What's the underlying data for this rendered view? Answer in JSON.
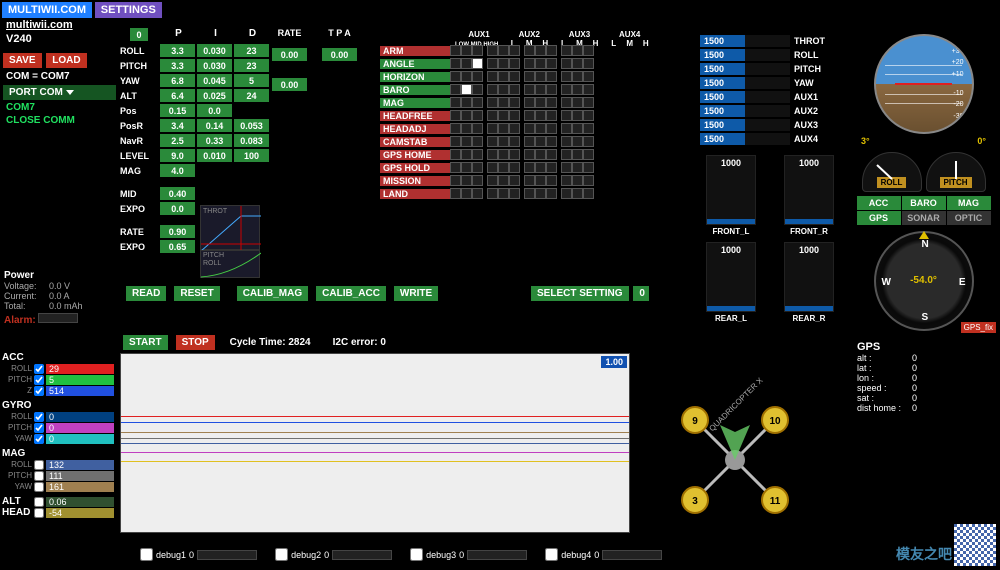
{
  "tabs": {
    "multiwii": "MULTIWII.COM",
    "settings": "SETTINGS"
  },
  "header": {
    "site": "multiwii.com",
    "version": "V240"
  },
  "file": {
    "save": "SAVE",
    "load": "LOAD"
  },
  "com_status": "COM = COM7",
  "port": {
    "port_com": "PORT COM",
    "com7": "COM7",
    "close": "CLOSE COMM"
  },
  "power": {
    "title": "Power",
    "voltage_lbl": "Voltage:",
    "voltage": "0.0 V",
    "current_lbl": "Current:",
    "current": "0.0 A",
    "total_lbl": "Total:",
    "total": "0.0 mAh",
    "alarm": "Alarm:"
  },
  "sensors": {
    "acc": {
      "hdr": "ACC",
      "roll": "29",
      "pitch": "5",
      "z": "514"
    },
    "gyro": {
      "hdr": "GYRO",
      "roll": "0",
      "pitch": "0",
      "yaw": "0"
    },
    "mag": {
      "hdr": "MAG",
      "roll": "132",
      "pitch": "111",
      "yaw": "161"
    },
    "alt": {
      "hdr": "ALT",
      "val": "0.06"
    },
    "head": {
      "hdr": "HEAD",
      "val": "-54"
    }
  },
  "axes": {
    "roll": "ROLL",
    "pitch": "PITCH",
    "yaw": "YAW",
    "z": "Z"
  },
  "pid": {
    "hdr": {
      "zero": "0",
      "p": "P",
      "i": "I",
      "d": "D",
      "rate": "RATE",
      "tpa": "T P A"
    },
    "rows": [
      {
        "name": "ROLL",
        "p": "3.3",
        "i": "0.030",
        "d": "23"
      },
      {
        "name": "PITCH",
        "p": "3.3",
        "i": "0.030",
        "d": "23"
      },
      {
        "name": "YAW",
        "p": "6.8",
        "i": "0.045",
        "d": "5"
      },
      {
        "name": "ALT",
        "p": "6.4",
        "i": "0.025",
        "d": "24"
      },
      {
        "name": "Pos",
        "p": "0.15",
        "i": "0.0"
      },
      {
        "name": "PosR",
        "p": "3.4",
        "i": "0.14",
        "d": "0.053"
      },
      {
        "name": "NavR",
        "p": "2.5",
        "i": "0.33",
        "d": "0.083"
      },
      {
        "name": "LEVEL",
        "p": "9.0",
        "i": "0.010",
        "d": "100"
      },
      {
        "name": "MAG",
        "p": "4.0"
      }
    ],
    "mid": {
      "name": "MID",
      "val": "0.40"
    },
    "expo": {
      "name": "EXPO",
      "val": "0.0"
    },
    "rate": {
      "name": "RATE",
      "val": "0.90"
    },
    "expo2": {
      "name": "EXPO",
      "val": "0.65"
    },
    "rate_tpa": {
      "pitch_roll": "0.00",
      "yaw": "0.00",
      "tpa": "0.00"
    }
  },
  "throt_labels": {
    "throt": "THROT",
    "pitch": "PITCH",
    "roll": "ROLL"
  },
  "actions": {
    "read": "READ",
    "reset": "RESET",
    "calib_mag": "CALIB_MAG",
    "calib_acc": "CALIB_ACC",
    "write": "WRITE",
    "select_setting": "SELECT SETTING",
    "setting_val": "0",
    "start": "START",
    "stop": "STOP"
  },
  "cycle": {
    "label": "Cycle Time:",
    "val": "2824",
    "i2c_label": "I2C error:",
    "i2c_val": "0"
  },
  "scale_val": "1.00",
  "aux_hdr": {
    "aux1": "AUX1",
    "aux2": "AUX2",
    "aux3": "AUX3",
    "aux4": "AUX4",
    "lmh": "LOW MID HIGH",
    "l": "L",
    "m": "M",
    "h": "H"
  },
  "modes": [
    "ARM",
    "ANGLE",
    "HORIZON",
    "BARO",
    "MAG",
    "HEADFREE",
    "HEADADJ",
    "CAMSTAB",
    "GPS HOME",
    "GPS HOLD",
    "MISSION",
    "LAND"
  ],
  "rc": [
    {
      "val": "1500",
      "lbl": "THROT"
    },
    {
      "val": "1500",
      "lbl": "ROLL"
    },
    {
      "val": "1500",
      "lbl": "PITCH"
    },
    {
      "val": "1500",
      "lbl": "YAW"
    },
    {
      "val": "1500",
      "lbl": "AUX1"
    },
    {
      "val": "1500",
      "lbl": "AUX2"
    },
    {
      "val": "1500",
      "lbl": "AUX3"
    },
    {
      "val": "1500",
      "lbl": "AUX4"
    }
  ],
  "motors": [
    {
      "val": "1000",
      "lbl": "FRONT_L"
    },
    {
      "val": "1000",
      "lbl": "FRONT_R"
    },
    {
      "val": "1000",
      "lbl": "REAR_L"
    },
    {
      "val": "1000",
      "lbl": "REAR_R"
    }
  ],
  "motor_ids": {
    "m3": "3",
    "m9": "9",
    "m10": "10",
    "m11": "11"
  },
  "copter_type": "QUADRICOPTER X",
  "angles": {
    "roll": "3°",
    "pitch": "0°"
  },
  "gauges": {
    "roll": "ROLL",
    "pitch": "PITCH"
  },
  "sensor_btns": {
    "acc": "ACC",
    "baro": "BARO",
    "mag": "MAG",
    "gps": "GPS",
    "sonar": "SONAR",
    "optic": "OPTIC"
  },
  "compass": {
    "n": "N",
    "s": "S",
    "e": "E",
    "w": "W",
    "val": "-54.0°",
    "gps_fix": "GPS_fix"
  },
  "gps": {
    "hdr": "GPS",
    "alt": "alt    :",
    "alt_v": "0",
    "lat": "lat    :",
    "lat_v": "0",
    "lon": "lon   :",
    "lon_v": "0",
    "speed": "speed :",
    "speed_v": "0",
    "sat": "sat    :",
    "sat_v": "0",
    "dist": "dist home :",
    "dist_v": "0"
  },
  "debug": {
    "d1": "debug1",
    "d2": "debug2",
    "d3": "debug3",
    "d4": "debug4",
    "v": "0"
  },
  "watermark": "模友之吧",
  "horizon_marks": [
    "+30",
    "+20",
    "+10",
    "-10",
    "-20",
    "-30"
  ]
}
